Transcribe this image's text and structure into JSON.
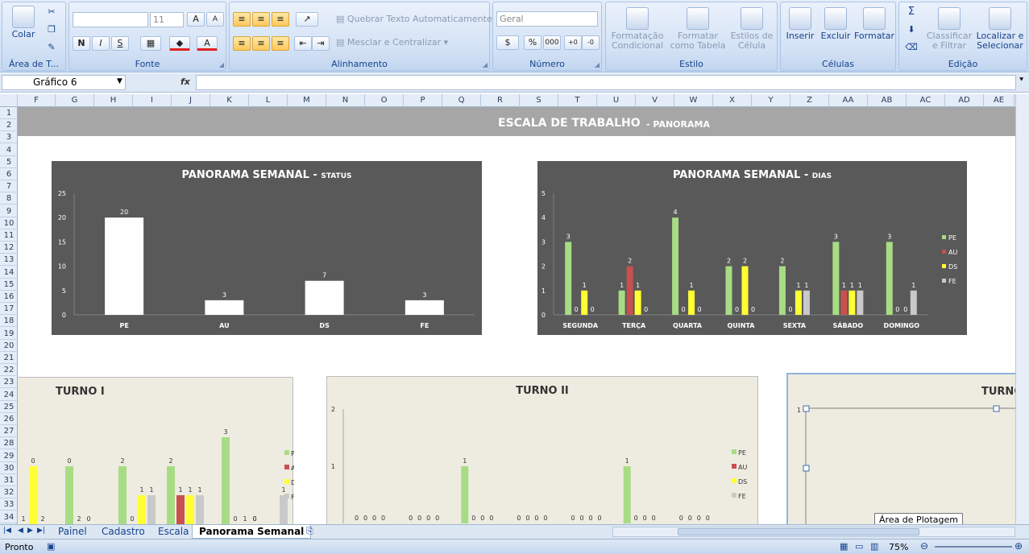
{
  "ribbon": {
    "clipboard": {
      "paste": "Colar",
      "group": "Área de T..."
    },
    "font": {
      "name": "",
      "size": "11",
      "bold": "N",
      "italic": "I",
      "underline": "S",
      "group": "Fonte"
    },
    "alignment": {
      "wrap": "Quebrar Texto Automaticamente",
      "merge": "Mesclar e Centralizar",
      "group": "Alinhamento"
    },
    "number": {
      "format": "Geral",
      "percent": "%",
      "thousands": "000",
      "group": "Número"
    },
    "style": {
      "conditional": "Formatação Condicional",
      "table": "Formatar como Tabela",
      "cell": "Estilos de Célula",
      "group": "Estilo"
    },
    "cells": {
      "insert": "Inserir",
      "delete": "Excluir",
      "format": "Formatar",
      "group": "Células"
    },
    "edit": {
      "sum": "Σ",
      "sort": "Classificar e Filtrar",
      "find": "Localizar e Selecionar",
      "group": "Edição"
    }
  },
  "formula_bar": {
    "name_box": "Gráfico 6",
    "fx": "fx",
    "value": ""
  },
  "columns": [
    "F",
    "G",
    "H",
    "I",
    "J",
    "K",
    "L",
    "M",
    "N",
    "O",
    "P",
    "Q",
    "R",
    "S",
    "T",
    "U",
    "V",
    "W",
    "X",
    "Y",
    "Z",
    "AA",
    "AB",
    "AC",
    "AD",
    "AE"
  ],
  "rows": [
    "1",
    "2",
    "3",
    "4",
    "5",
    "6",
    "7",
    "8",
    "9",
    "10",
    "11",
    "12",
    "13",
    "14",
    "15",
    "16",
    "17",
    "18",
    "19",
    "20",
    "21",
    "22",
    "23",
    "24",
    "25",
    "26",
    "27",
    "28",
    "29",
    "30",
    "31",
    "32",
    "33",
    "34"
  ],
  "sheet": {
    "title": "ESCALA DE TRABALHO",
    "subtitle": "- PANORAMA"
  },
  "colors": {
    "PE": "#a8dc84",
    "AU": "#c9504f",
    "DS": "#ffff33",
    "FE": "#c9c9c9",
    "dark_bg": "#595959",
    "light_bg": "#eeece1"
  },
  "chart_data": [
    {
      "type": "bar",
      "title": "PANORAMA SEMANAL -",
      "title_suffix": "STATUS",
      "categories": [
        "PE",
        "AU",
        "DS",
        "FE"
      ],
      "values": [
        20,
        3,
        7,
        3
      ],
      "ylim": [
        0,
        25
      ],
      "yticks": [
        0,
        5,
        10,
        15,
        20,
        25
      ],
      "grid": false
    },
    {
      "type": "bar",
      "title": "PANORAMA SEMANAL -",
      "title_suffix": "DIAS",
      "categories": [
        "SEGUNDA",
        "TERÇA",
        "QUARTA",
        "QUINTA",
        "SEXTA",
        "SÁBADO",
        "DOMINGO"
      ],
      "series": [
        {
          "name": "PE",
          "values": [
            3,
            1,
            4,
            2,
            2,
            3,
            3
          ]
        },
        {
          "name": "AU",
          "values": [
            0,
            2,
            0,
            0,
            0,
            1,
            0
          ]
        },
        {
          "name": "DS",
          "values": [
            1,
            1,
            1,
            2,
            1,
            1,
            0
          ]
        },
        {
          "name": "FE",
          "values": [
            0,
            0,
            0,
            0,
            1,
            1,
            1
          ]
        }
      ],
      "ylim": [
        0,
        5
      ],
      "yticks": [
        0,
        1,
        2,
        3,
        4,
        5
      ],
      "legend": "right",
      "grid": false
    },
    {
      "type": "bar",
      "title": "TURNO I",
      "series": [
        {
          "name": "PE",
          "values": [
            null,
            2,
            2,
            2,
            3,
            0
          ]
        },
        {
          "name": "AU",
          "values": [
            0,
            0,
            0,
            1,
            0,
            null
          ]
        },
        {
          "name": "DS",
          "values": [
            2,
            0,
            1,
            1,
            0,
            null
          ]
        },
        {
          "name": "FE",
          "values": [
            0,
            null,
            1,
            1,
            0,
            1
          ]
        }
      ],
      "value_labels": [
        "1",
        "0",
        "2",
        "0",
        "2",
        "0",
        "2",
        "0",
        "1",
        "1",
        "2",
        "1",
        "1",
        "1",
        "3",
        "0",
        "1"
      ],
      "legend": "right"
    },
    {
      "type": "bar",
      "title": "TURNO II",
      "series": [
        {
          "name": "PE",
          "values": [
            0,
            0,
            1,
            0,
            0,
            1,
            0
          ]
        },
        {
          "name": "AU",
          "values": [
            0,
            0,
            0,
            0,
            0,
            0,
            0
          ]
        },
        {
          "name": "DS",
          "values": [
            0,
            0,
            0,
            0,
            0,
            0,
            0
          ]
        },
        {
          "name": "FE",
          "values": [
            0,
            0,
            0,
            0,
            0,
            0,
            0
          ]
        }
      ],
      "ylim": [
        0,
        2
      ],
      "yticks": [
        1,
        2
      ],
      "legend": "right"
    },
    {
      "type": "bar",
      "title": "TURNO",
      "yticks": [
        1
      ]
    }
  ],
  "sheet_tabs": [
    "Painel",
    "Cadastro",
    "Escala",
    "Panorama Semanal"
  ],
  "active_tab": "Panorama Semanal",
  "status": {
    "mode": "Pronto",
    "zoom": "75%"
  },
  "tooltip": "Área de Plotagem"
}
